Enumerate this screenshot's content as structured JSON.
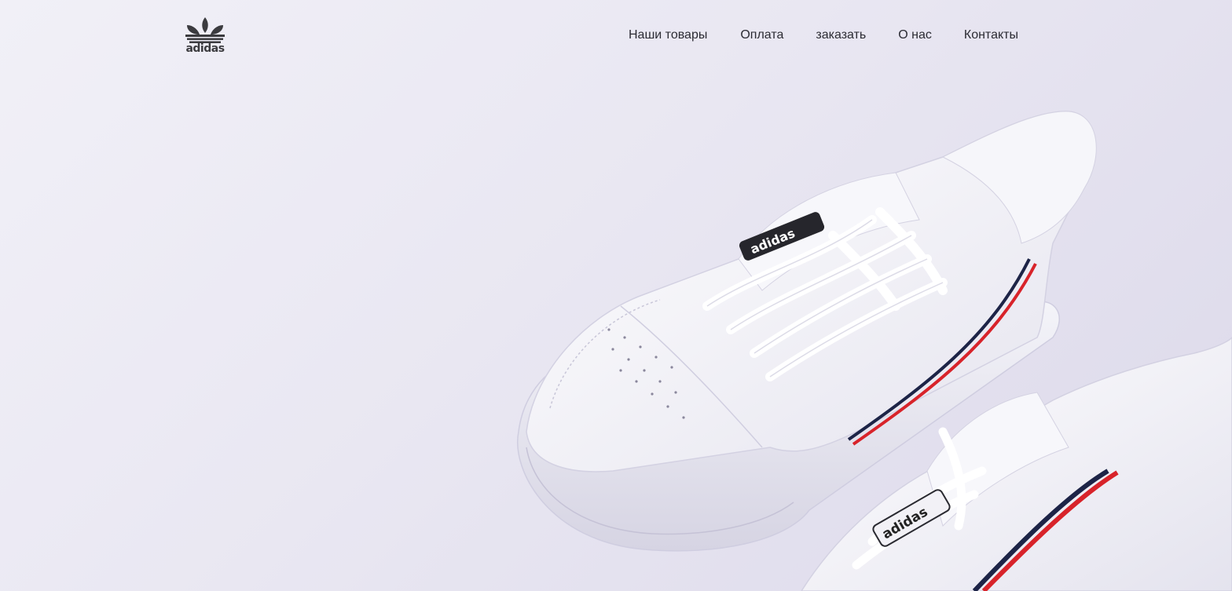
{
  "brand": {
    "logo_text": "adidas",
    "logo_icon": "adidas-trefoil-icon"
  },
  "nav": {
    "items": [
      {
        "label": "Наши товары"
      },
      {
        "label": "Оплата"
      },
      {
        "label": "заказать"
      },
      {
        "label": "О нас"
      },
      {
        "label": "Контакты"
      }
    ]
  },
  "hero": {
    "image": "white-sneakers-hero-image",
    "shoe_stripe_colors": [
      "#d8232a",
      "#1d2447"
    ],
    "background_colors": [
      "#f1f0f7",
      "#dcd9ea"
    ]
  }
}
